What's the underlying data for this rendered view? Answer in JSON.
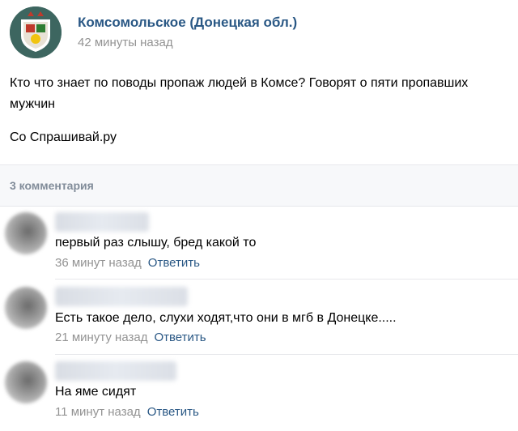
{
  "post": {
    "group_name": "Комсомольское (Донецкая обл.)",
    "time": "42 минуты назад",
    "text": "Кто что знает по поводы пропаж людей в Комсе? Говорят о пяти пропавших мужчин",
    "source": "Со Спрашивай.ру"
  },
  "comments_header": {
    "count_label": "3 комментария"
  },
  "comments": [
    {
      "text": "первый раз слышу, бред какой то",
      "time": "36 минут назад",
      "reply_label": "Ответить"
    },
    {
      "text": "Есть такое дело, слухи ходят,что они в мгб в Донецке.....",
      "time": "21 минуту назад",
      "reply_label": "Ответить"
    },
    {
      "text": "На яме сидят",
      "time": "11 минут назад",
      "reply_label": "Ответить"
    }
  ],
  "colors": {
    "link": "#2a5885",
    "muted": "#939393",
    "header_bg": "#f7f8fa",
    "divider": "#e7e8ec"
  }
}
